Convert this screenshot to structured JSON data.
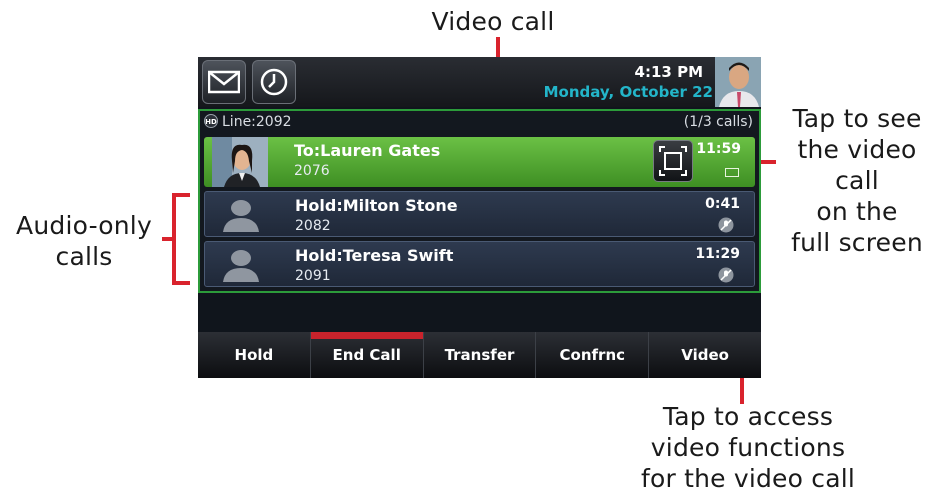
{
  "callouts": {
    "video_call": "Video call",
    "audio_only_line1": "Audio-only",
    "audio_only_line2": "calls",
    "fullscreen_line1": "Tap to see",
    "fullscreen_line2": "the video call",
    "fullscreen_line3": "on the",
    "fullscreen_line4": "full screen",
    "video_functions_line1": "Tap to access",
    "video_functions_line2": "video functions",
    "video_functions_line3": "for the video call"
  },
  "status_bar": {
    "time": "4:13 PM",
    "date": "Monday, October 22"
  },
  "line": {
    "label": "Line:2092",
    "count": "(1/3 calls)"
  },
  "calls": [
    {
      "name": "To:Lauren Gates",
      "number": "2076",
      "timer": "11:59",
      "state": "active"
    },
    {
      "name": "Hold:Milton Stone",
      "number": "2082",
      "timer": "0:41",
      "state": "held"
    },
    {
      "name": "Hold:Teresa Swift",
      "number": "2091",
      "timer": "11:29",
      "state": "held"
    }
  ],
  "softkeys": [
    "Hold",
    "End Call",
    "Transfer",
    "Confrnc",
    "Video"
  ],
  "colors": {
    "accent_red": "#d9232d",
    "active_green": "#4fa72d",
    "date_cyan": "#23b5c9",
    "panel_border": "#2c9b3a"
  },
  "icons": {
    "messages": "envelope-icon",
    "history": "clock-icon",
    "fullscreen": "fullscreen-icon",
    "mute": "mute-icon",
    "video": "video-icon"
  }
}
